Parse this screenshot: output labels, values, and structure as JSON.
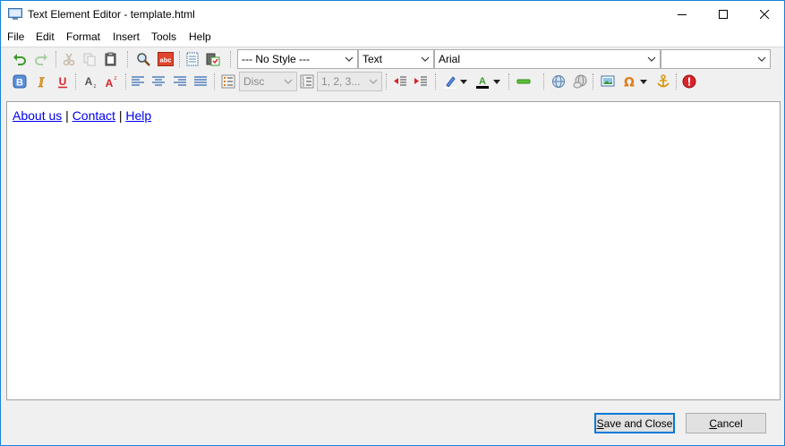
{
  "window": {
    "title": "Text Element Editor - template.html"
  },
  "menu": [
    "File",
    "Edit",
    "Format",
    "Insert",
    "Tools",
    "Help"
  ],
  "toolbar": {
    "style_combo": "--- No Style ---",
    "type_combo": "Text",
    "font_combo": "Arial",
    "size_combo": "",
    "bullet_combo": "Disc",
    "numbering_combo": "1, 2, 3..."
  },
  "editor": {
    "links": [
      "About us",
      "Contact",
      "Help"
    ],
    "separator": "|"
  },
  "buttons": {
    "save_first": "S",
    "save_rest": "ave and Close",
    "cancel_first": "C",
    "cancel_rest": "ancel"
  },
  "colors": {
    "accent": "#0078d7",
    "link": "#0000ee",
    "window_border": "#1883d7"
  }
}
